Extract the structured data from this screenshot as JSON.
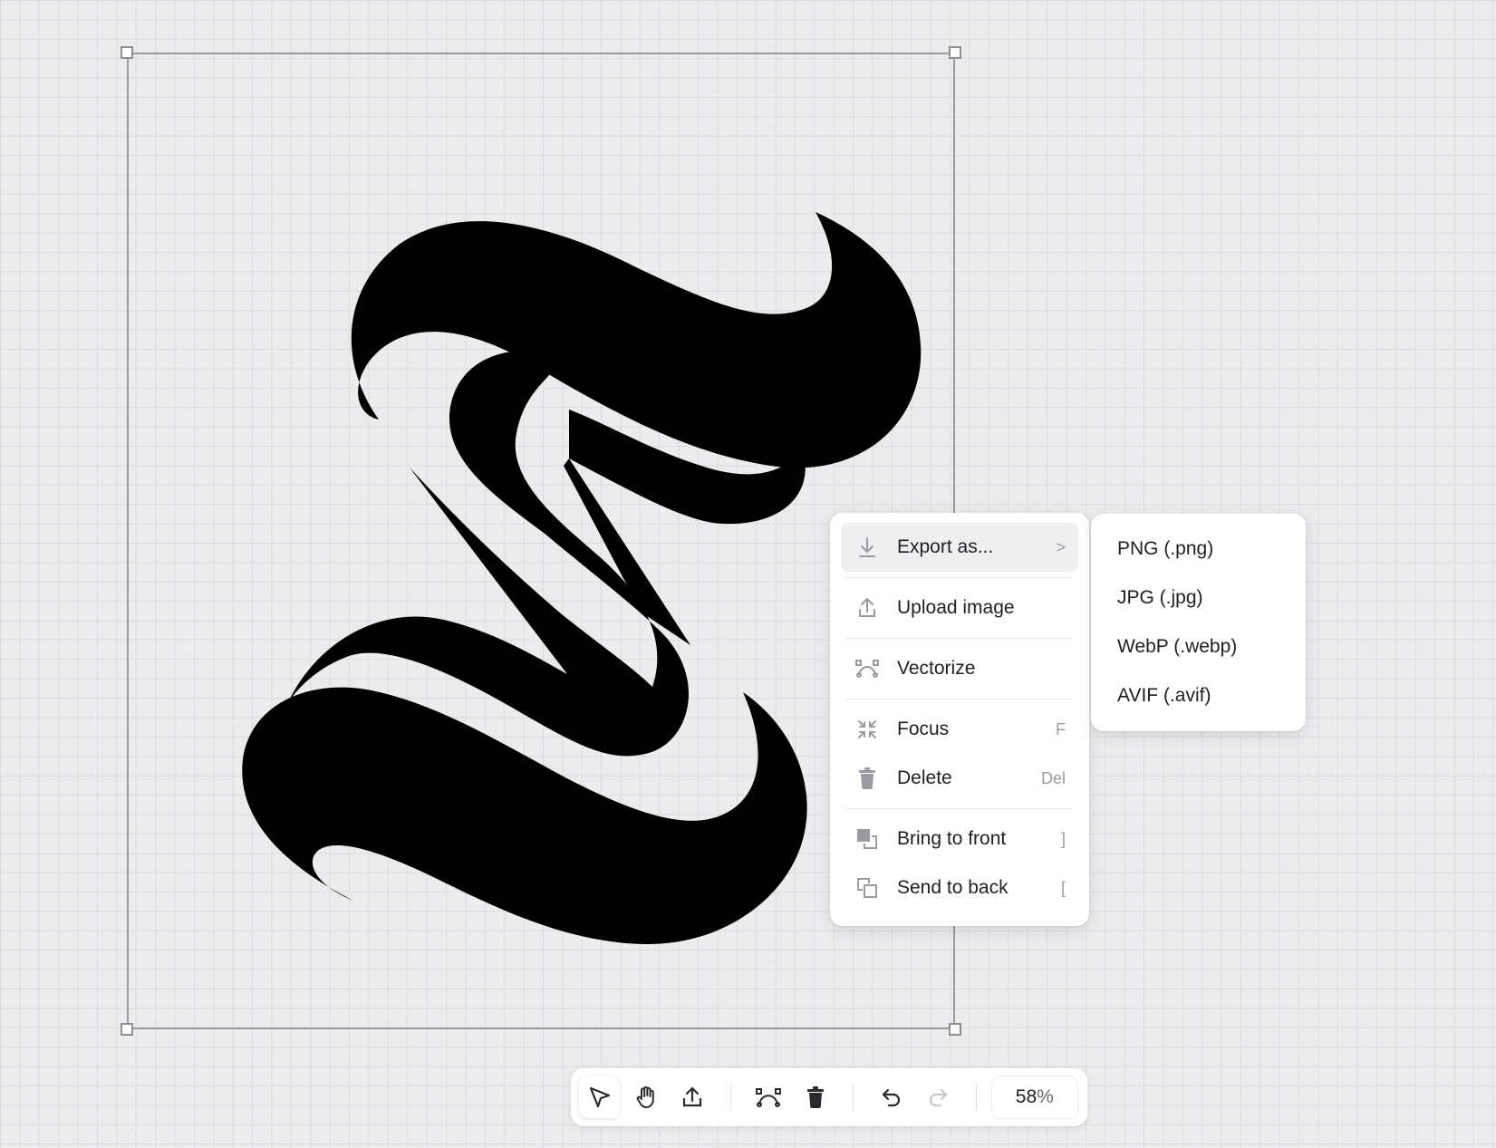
{
  "context_menu": {
    "items": [
      {
        "label": "Export as...",
        "shortcut": "",
        "icon": "download-icon",
        "has_submenu": true
      },
      {
        "label": "Upload image",
        "shortcut": "",
        "icon": "upload-icon"
      },
      {
        "label": "Vectorize",
        "shortcut": "",
        "icon": "bezier-icon"
      },
      {
        "label": "Focus",
        "shortcut": "F",
        "icon": "focus-icon"
      },
      {
        "label": "Delete",
        "shortcut": "Del",
        "icon": "trash-icon"
      },
      {
        "label": "Bring to front",
        "shortcut": "]",
        "icon": "bring-to-front-icon"
      },
      {
        "label": "Send to back",
        "shortcut": "[",
        "icon": "send-to-back-icon"
      }
    ],
    "submenu_arrow": ">"
  },
  "export_submenu": {
    "items": [
      "PNG (.png)",
      "JPG (.jpg)",
      "WebP (.webp)",
      "AVIF (.avif)"
    ]
  },
  "toolbar": {
    "tools": [
      "select-tool",
      "hand-tool",
      "upload-tool",
      "vectorize-tool",
      "delete-tool",
      "undo",
      "redo"
    ],
    "zoom_value": "58",
    "zoom_unit": "%"
  },
  "colors": {
    "artwork": "#000000",
    "menu_active": "#efeff1",
    "canvas": "#ececef"
  }
}
